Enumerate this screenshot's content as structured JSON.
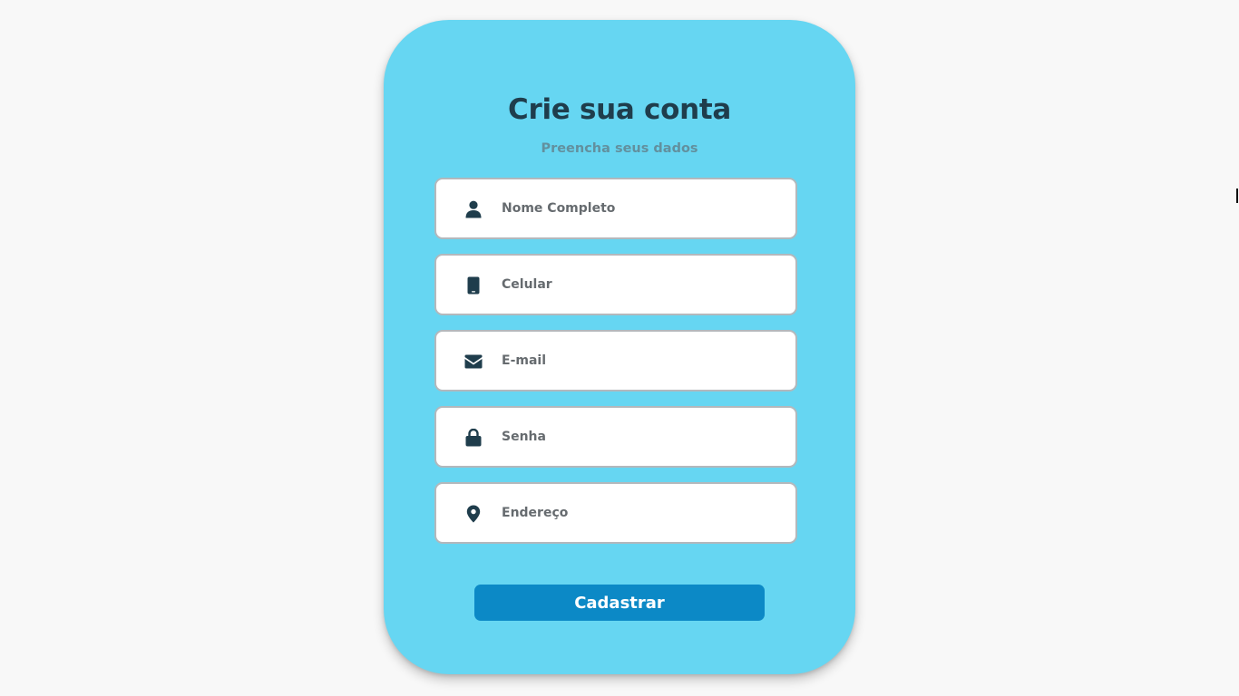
{
  "form": {
    "title": "Crie sua conta",
    "subtitle": "Preencha seus dados",
    "fields": [
      {
        "icon": "user-icon",
        "placeholder": "Nome Completo",
        "value": ""
      },
      {
        "icon": "mobile-phone-icon",
        "placeholder": "Celular",
        "value": ""
      },
      {
        "icon": "envelope-icon",
        "placeholder": "E-mail",
        "value": ""
      },
      {
        "icon": "lock-icon",
        "placeholder": "Senha",
        "value": ""
      },
      {
        "icon": "map-pin-icon",
        "placeholder": "Endereço",
        "value": ""
      }
    ],
    "submit_label": "Cadastrar"
  },
  "colors": {
    "page_background": "#f8f8f8",
    "card_background": "#66d6f2",
    "title": "#1f3d4c",
    "subtitle": "#62909e",
    "icon": "#1f3d4c",
    "button": "#0c89c6",
    "button_text": "#ffffff"
  }
}
